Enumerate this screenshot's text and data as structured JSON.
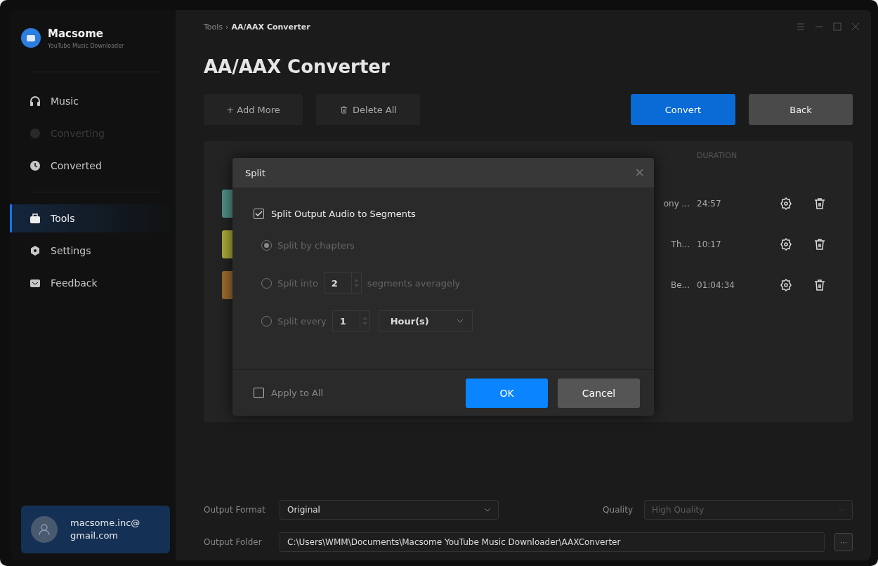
{
  "app": {
    "name": "Macsome",
    "subtitle": "YouTube Music Downloader"
  },
  "sidebar": {
    "items": [
      {
        "label": "Music",
        "selected": false,
        "disabled": false
      },
      {
        "label": "Converting",
        "selected": false,
        "disabled": true
      },
      {
        "label": "Converted",
        "selected": false,
        "disabled": false
      },
      {
        "label": "Tools",
        "selected": true,
        "disabled": false
      },
      {
        "label": "Settings",
        "selected": false,
        "disabled": false
      },
      {
        "label": "Feedback",
        "selected": false,
        "disabled": false
      }
    ],
    "user": {
      "email": "macsome.inc@ gmail.com"
    }
  },
  "breadcrumb": {
    "parent": "Tools",
    "separator": "›",
    "current": "AA/AAX Converter"
  },
  "title": "AA/AAX Converter",
  "toolbar": {
    "add": "+ Add More",
    "delete": "Delete All",
    "convert": "Convert",
    "back": "Back"
  },
  "table": {
    "columns": [
      "DURATION"
    ],
    "rows": [
      {
        "title": "ony ...",
        "duration": "24:57"
      },
      {
        "title": "Th...",
        "duration": "10:17"
      },
      {
        "title": "Be...",
        "duration": "01:04:34"
      }
    ]
  },
  "dialog": {
    "title": "Split",
    "close": "×",
    "split_enabled": {
      "label": "Split Output Audio to Segments",
      "checked": true
    },
    "options": [
      {
        "kind": "plain",
        "selected": true,
        "label": "Split by chapters"
      },
      {
        "kind": "count",
        "selected": false,
        "label": "Split into",
        "value": "2",
        "suffix": "segments averagely"
      },
      {
        "kind": "interval",
        "selected": false,
        "label": "Split every",
        "value": "1",
        "unit": "Hour(s)"
      }
    ],
    "apply_all": {
      "label": "Apply to All",
      "checked": false
    },
    "ok": "OK",
    "cancel": "Cancel"
  },
  "output": {
    "format_label": "Output Format",
    "format": "Original",
    "quality_label": "Quality",
    "quality": "High Quality",
    "quality_disabled": true,
    "folder_label": "Output Folder",
    "folder": "C:\\Users\\WMM\\Documents\\Macsome YouTube Music Downloader\\AAXConverter",
    "browse": "···"
  }
}
